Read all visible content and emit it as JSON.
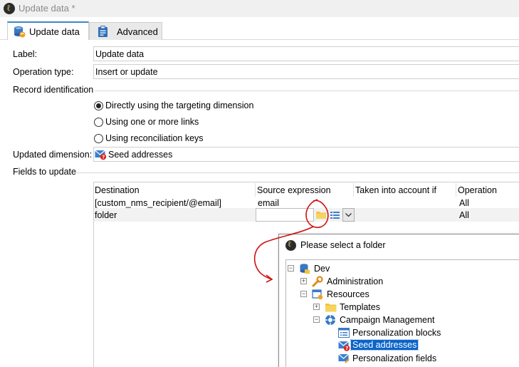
{
  "window": {
    "title": "Update data *"
  },
  "tabs": [
    {
      "label": "Update data",
      "active": true
    },
    {
      "label": "Advanced",
      "active": false
    }
  ],
  "form": {
    "label_caption": "Label:",
    "label_value": "Update data",
    "operation_caption": "Operation type:",
    "operation_value": "Insert or update",
    "record_id_caption": "Record identification",
    "radios": [
      {
        "label": "Directly using the targeting dimension",
        "checked": true
      },
      {
        "label": "Using one or more links",
        "checked": false
      },
      {
        "label": "Using reconciliation keys",
        "checked": false
      }
    ],
    "updated_dimension_caption": "Updated dimension:",
    "updated_dimension_value": "Seed addresses",
    "fields_caption": "Fields to update"
  },
  "grid": {
    "columns": [
      "Destination",
      "Source expression",
      "Taken into account if",
      "Operation"
    ],
    "rows": [
      {
        "destination": "[custom_nms_recipient/@email]",
        "source": "email",
        "condition": "",
        "operation": "All"
      },
      {
        "destination": "folder",
        "source": "",
        "condition": "",
        "operation": "All"
      }
    ]
  },
  "dialog": {
    "title": "Please select a folder",
    "tree": [
      {
        "label": "Dev",
        "expander": "minus",
        "icon": "database-folder-icon"
      },
      {
        "label": "Administration",
        "expander": "plus",
        "icon": "wrench-icon"
      },
      {
        "label": "Resources",
        "expander": "minus",
        "icon": "resources-icon"
      },
      {
        "label": "Templates",
        "expander": "plus",
        "icon": "folder-icon"
      },
      {
        "label": "Campaign Management",
        "expander": "minus",
        "icon": "campaign-icon"
      },
      {
        "label": "Personalization blocks",
        "expander": "",
        "icon": "list-icon"
      },
      {
        "label": "Seed addresses",
        "expander": "",
        "icon": "seed-address-icon",
        "selected": true
      },
      {
        "label": "Personalization fields",
        "expander": "",
        "icon": "envelope-icon"
      }
    ]
  },
  "colors": {
    "tab_accent": "#3a87c8",
    "selection": "#0a64c8",
    "annotation": "#d01010",
    "folder": "#f2c33c"
  }
}
